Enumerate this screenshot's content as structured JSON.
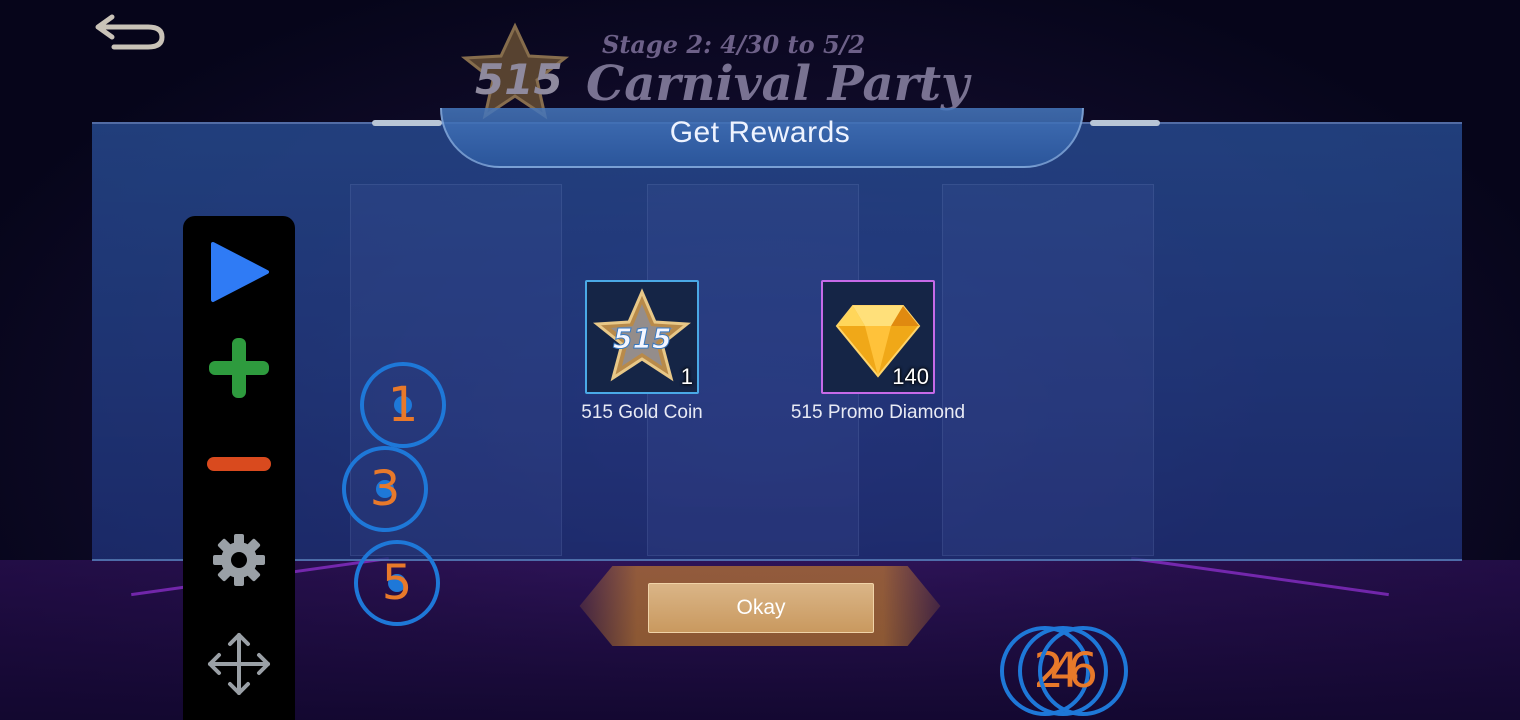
{
  "event": {
    "stage": "Stage 2: 4/30 to 5/2",
    "title": "Carnival Party"
  },
  "dialog": {
    "title": "Get Rewards",
    "rewards": [
      {
        "name": "515 Gold Coin",
        "count": "1",
        "icon": "gold-coin-icon",
        "frame_color": "#4aa9e6"
      },
      {
        "name": "515 Promo Diamond",
        "count": "140",
        "icon": "diamond-icon",
        "frame_color": "#c66ae8"
      }
    ],
    "okay_label": "Okay"
  },
  "toolbar": {
    "items": [
      {
        "icon": "play-icon",
        "color": "#2f7bf5"
      },
      {
        "icon": "plus-icon",
        "color": "#2e9b3e"
      },
      {
        "icon": "minus-icon",
        "color": "#d94a1e"
      },
      {
        "icon": "gear-icon",
        "color": "#9aa0a6"
      },
      {
        "icon": "move-icon",
        "color": "#9aa0a6"
      }
    ]
  },
  "markers": {
    "m1": "1",
    "m3": "3",
    "m5": "5",
    "m2": "2",
    "m4": "4",
    "m6": "6"
  },
  "colors": {
    "marker_ring": "#1e78d8",
    "marker_number": "#e8792a",
    "okay_button": "#d2a874"
  }
}
